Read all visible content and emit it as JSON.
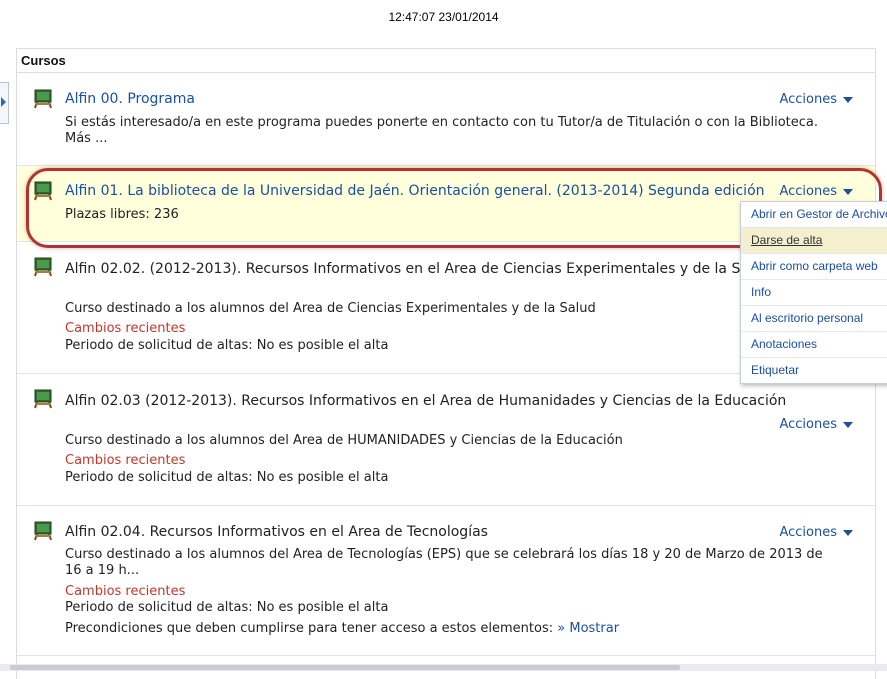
{
  "timestamp": "12:47:07 23/01/2014",
  "panel": {
    "header": "Cursos"
  },
  "courses": [
    {
      "title": "Alfin 00. Programa",
      "lines": [
        "Si estás interesado/a en este programa puedes ponerte en contacto con tu Tutor/a de Titulación o con la Biblioteca.",
        "Más ..."
      ],
      "actions_label": "Acciones"
    },
    {
      "title": "Alfin 01. La biblioteca de la Universidad de Jaén. Orientación general. (2013-2014) Segunda edición",
      "lines": [
        "Plazas libres: 236"
      ],
      "actions_label": "Acciones"
    },
    {
      "title": "Alfin 02.02. (2012-2013). Recursos Informativos en el Area de Ciencias Experimentales y de la Salud",
      "lines": [
        "Curso destinado a los alumnos del Area de Ciencias Experimentales y de la Salud"
      ],
      "recent": "Cambios recientes",
      "period": "Periodo de solicitud de altas: No es posible el alta"
    },
    {
      "title": "Alfin 02.03 (2012-2013). Recursos Informativos en el Area de Humanidades y Ciencias de la Educación",
      "lines": [
        "Curso destinado a los alumnos del Area de HUMANIDADES y Ciencias de la Educación"
      ],
      "recent": "Cambios recientes",
      "period": "Periodo de solicitud de altas: No es posible el alta",
      "actions_label": "Acciones"
    },
    {
      "title": "Alfin 02.04. Recursos Informativos en el Area de Tecnologías",
      "lines": [
        "Curso destinado a los alumnos del Area de Tecnologías (EPS) que se celebrará los días 18 y 20 de Marzo de 2013 de",
        "16 a 19 h..."
      ],
      "recent": "Cambios recientes",
      "period": "Periodo de solicitud de altas: No es posible el alta",
      "preconditions": "Precondiciones que deben cumplirse para tener acceso a estos elementos:",
      "show_label": "» Mostrar",
      "actions_label": "Acciones"
    }
  ],
  "dropdown_menu": {
    "items": [
      "Abrir en Gestor de Archivos",
      "Darse de alta",
      "Abrir como carpeta web",
      "Info",
      "Al escritorio personal",
      "Anotaciones",
      "Etiquetar"
    ]
  },
  "colors": {
    "link": "#1b4fa0",
    "recent": "#c0392b",
    "highlight_bg": "#ffffdc",
    "oval": "#b0352f"
  },
  "icon_name": "course-board-icon"
}
